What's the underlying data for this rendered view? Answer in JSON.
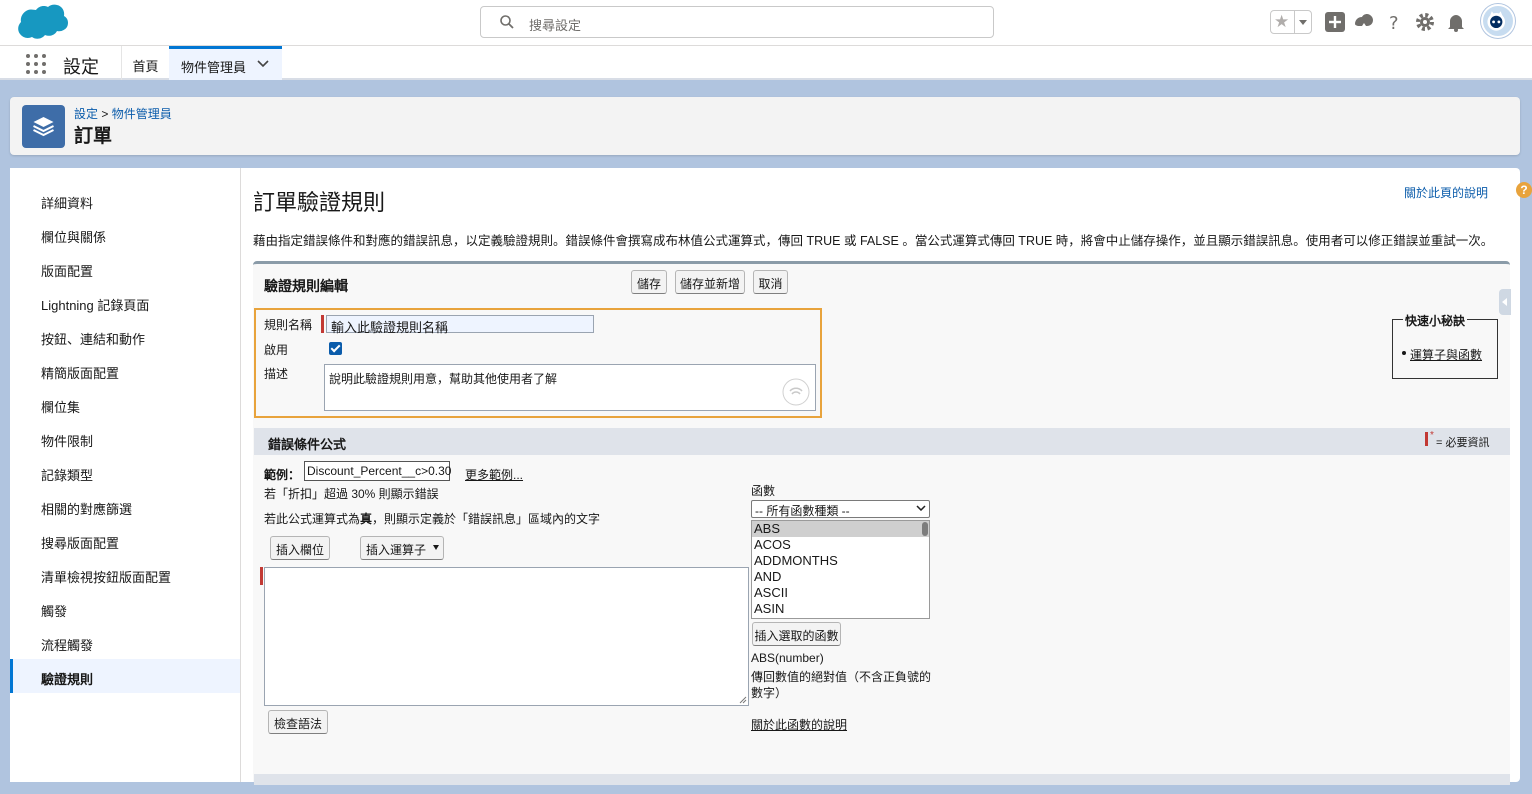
{
  "header": {
    "search_placeholder": "搜尋設定"
  },
  "nav": {
    "app_name": "設定",
    "tabs": [
      {
        "label": "首頁"
      },
      {
        "label": "物件管理員"
      }
    ]
  },
  "page_header": {
    "breadcrumb_1": "設定",
    "breadcrumb_sep": ">",
    "breadcrumb_2": "物件管理員",
    "title": "訂單"
  },
  "sidebar": {
    "items": [
      {
        "label": "詳細資料"
      },
      {
        "label": "欄位與關係"
      },
      {
        "label": "版面配置"
      },
      {
        "label": "Lightning 記錄頁面"
      },
      {
        "label": "按鈕、連結和動作"
      },
      {
        "label": "精簡版面配置"
      },
      {
        "label": "欄位集"
      },
      {
        "label": "物件限制"
      },
      {
        "label": "記錄類型"
      },
      {
        "label": "相關的對應篩選"
      },
      {
        "label": "搜尋版面配置"
      },
      {
        "label": "清單檢視按鈕版面配置"
      },
      {
        "label": "觸發"
      },
      {
        "label": "流程觸發"
      },
      {
        "label": "驗證規則"
      }
    ],
    "active_index": 14
  },
  "main": {
    "title": "訂單驗證規則",
    "help_link": "關於此頁的說明",
    "description": "藉由指定錯誤條件和對應的錯誤訊息，以定義驗證規則。錯誤條件會撰寫成布林值公式運算式，傳回 TRUE 或 FALSE 。當公式運算式傳回 TRUE 時，將會中止儲存操作，並且顯示錯誤訊息。使用者可以修正錯誤並重試一次。"
  },
  "edit": {
    "heading": "驗證規則編輯",
    "save": "儲存",
    "save_new": "儲存並新增",
    "cancel": "取消",
    "rule_name_label": "規則名稱",
    "rule_name_value": "輸入此驗證規則名稱",
    "active_label": "啟用",
    "active_checked": true,
    "desc_label": "描述",
    "desc_value": "說明此驗證規則用意，幫助其他使用者了解"
  },
  "tips": {
    "title": "快速小秘訣",
    "link": "運算子與函數"
  },
  "formula": {
    "section_title": "錯誤條件公式",
    "required_note": "= 必要資訊",
    "example_label": "範例：",
    "example_value": "Discount_Percent__c>0.30",
    "more_examples": "更多範例...",
    "example_desc": "若「折扣」超過 30% 則顯示錯誤",
    "true_desc_pre": "若此公式運算式為",
    "true_desc_bold": "真",
    "true_desc_post": "，則顯示定義於「錯誤訊息」區域內的文字",
    "insert_field": "插入欄位",
    "insert_operator": "插入運算子",
    "check_syntax": "檢查語法",
    "functions_label": "函數",
    "function_category": "-- 所有函數種類 --",
    "function_list": [
      "ABS",
      "ACOS",
      "ADDMONTHS",
      "AND",
      "ASCII",
      "ASIN"
    ],
    "insert_function": "插入選取的函數",
    "function_signature": "ABS(number)",
    "function_desc": "傳回數值的絕對值（不含正負號的數字）",
    "function_help": "關於此函數的說明"
  },
  "colors": {
    "brand": "#0176d3",
    "highlight": "#e8a33c",
    "required": "#c23934"
  }
}
